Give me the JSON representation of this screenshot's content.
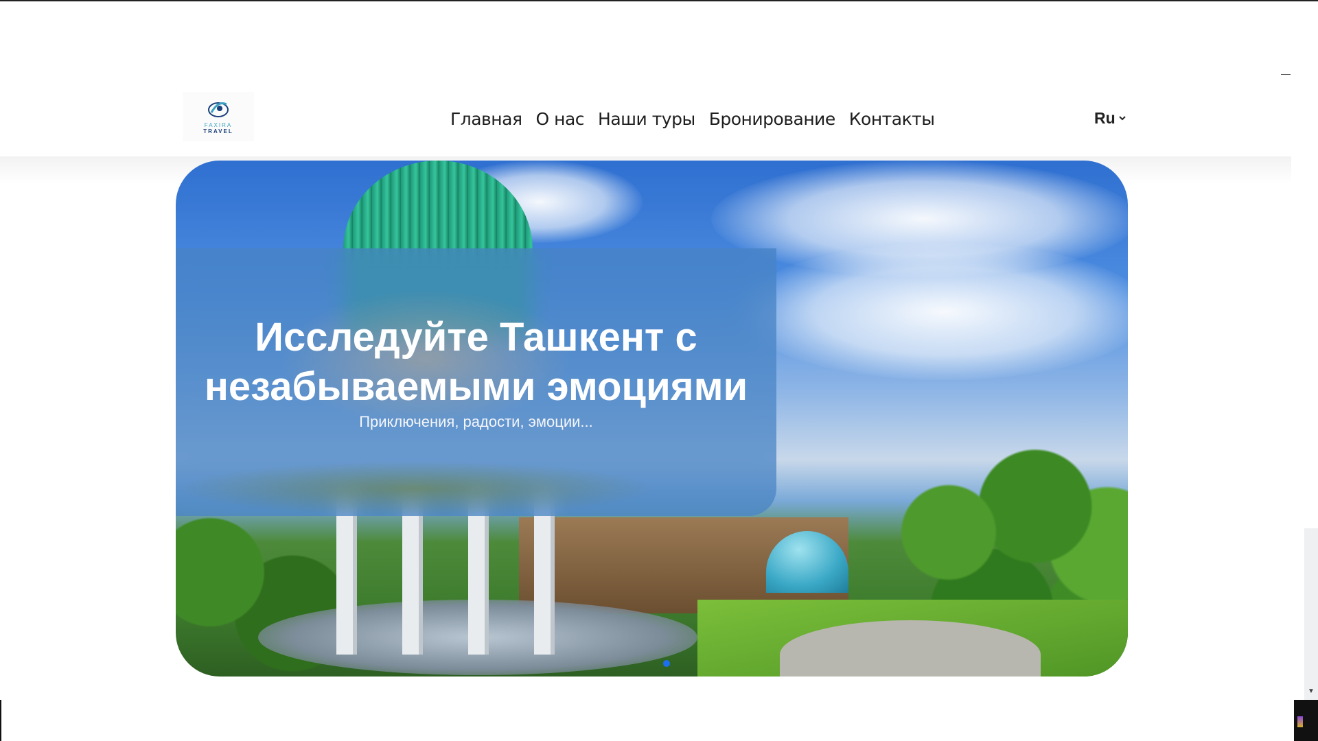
{
  "header": {
    "logo": {
      "name": "FAXIRA",
      "sub": "TRAVEL"
    },
    "nav": [
      {
        "label": "Главная"
      },
      {
        "label": "О нас"
      },
      {
        "label": "Наши туры"
      },
      {
        "label": "Бронирование"
      },
      {
        "label": "Контакты"
      }
    ],
    "language": {
      "selected": "Ru"
    }
  },
  "hero": {
    "title_line1": "Исследуйте Ташкент с",
    "title_line2": "незабываемыми эмоциями",
    "subtitle": "Приключения, радости, эмоции...",
    "slides_total": 1,
    "active_slide": 1
  },
  "colors": {
    "accent": "#1e6ff0",
    "nav_text": "#1e1e1e",
    "hero_panel": "#4682c3"
  },
  "icons": [
    "logo-icon",
    "chevron-down-icon",
    "scroll-down-arrow-icon"
  ]
}
